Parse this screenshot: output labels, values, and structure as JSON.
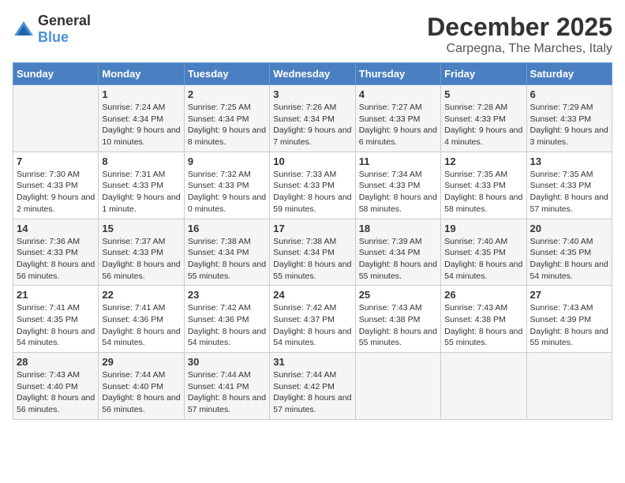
{
  "logo": {
    "general": "General",
    "blue": "Blue"
  },
  "title": "December 2025",
  "location": "Carpegna, The Marches, Italy",
  "weekdays": [
    "Sunday",
    "Monday",
    "Tuesday",
    "Wednesday",
    "Thursday",
    "Friday",
    "Saturday"
  ],
  "weeks": [
    [
      {
        "day": "",
        "sunrise": "",
        "sunset": "",
        "daylight": ""
      },
      {
        "day": "1",
        "sunrise": "Sunrise: 7:24 AM",
        "sunset": "Sunset: 4:34 PM",
        "daylight": "Daylight: 9 hours and 10 minutes."
      },
      {
        "day": "2",
        "sunrise": "Sunrise: 7:25 AM",
        "sunset": "Sunset: 4:34 PM",
        "daylight": "Daylight: 9 hours and 8 minutes."
      },
      {
        "day": "3",
        "sunrise": "Sunrise: 7:26 AM",
        "sunset": "Sunset: 4:34 PM",
        "daylight": "Daylight: 9 hours and 7 minutes."
      },
      {
        "day": "4",
        "sunrise": "Sunrise: 7:27 AM",
        "sunset": "Sunset: 4:33 PM",
        "daylight": "Daylight: 9 hours and 6 minutes."
      },
      {
        "day": "5",
        "sunrise": "Sunrise: 7:28 AM",
        "sunset": "Sunset: 4:33 PM",
        "daylight": "Daylight: 9 hours and 4 minutes."
      },
      {
        "day": "6",
        "sunrise": "Sunrise: 7:29 AM",
        "sunset": "Sunset: 4:33 PM",
        "daylight": "Daylight: 9 hours and 3 minutes."
      }
    ],
    [
      {
        "day": "7",
        "sunrise": "Sunrise: 7:30 AM",
        "sunset": "Sunset: 4:33 PM",
        "daylight": "Daylight: 9 hours and 2 minutes."
      },
      {
        "day": "8",
        "sunrise": "Sunrise: 7:31 AM",
        "sunset": "Sunset: 4:33 PM",
        "daylight": "Daylight: 9 hours and 1 minute."
      },
      {
        "day": "9",
        "sunrise": "Sunrise: 7:32 AM",
        "sunset": "Sunset: 4:33 PM",
        "daylight": "Daylight: 9 hours and 0 minutes."
      },
      {
        "day": "10",
        "sunrise": "Sunrise: 7:33 AM",
        "sunset": "Sunset: 4:33 PM",
        "daylight": "Daylight: 8 hours and 59 minutes."
      },
      {
        "day": "11",
        "sunrise": "Sunrise: 7:34 AM",
        "sunset": "Sunset: 4:33 PM",
        "daylight": "Daylight: 8 hours and 58 minutes."
      },
      {
        "day": "12",
        "sunrise": "Sunrise: 7:35 AM",
        "sunset": "Sunset: 4:33 PM",
        "daylight": "Daylight: 8 hours and 58 minutes."
      },
      {
        "day": "13",
        "sunrise": "Sunrise: 7:35 AM",
        "sunset": "Sunset: 4:33 PM",
        "daylight": "Daylight: 8 hours and 57 minutes."
      }
    ],
    [
      {
        "day": "14",
        "sunrise": "Sunrise: 7:36 AM",
        "sunset": "Sunset: 4:33 PM",
        "daylight": "Daylight: 8 hours and 56 minutes."
      },
      {
        "day": "15",
        "sunrise": "Sunrise: 7:37 AM",
        "sunset": "Sunset: 4:33 PM",
        "daylight": "Daylight: 8 hours and 56 minutes."
      },
      {
        "day": "16",
        "sunrise": "Sunrise: 7:38 AM",
        "sunset": "Sunset: 4:34 PM",
        "daylight": "Daylight: 8 hours and 55 minutes."
      },
      {
        "day": "17",
        "sunrise": "Sunrise: 7:38 AM",
        "sunset": "Sunset: 4:34 PM",
        "daylight": "Daylight: 8 hours and 55 minutes."
      },
      {
        "day": "18",
        "sunrise": "Sunrise: 7:39 AM",
        "sunset": "Sunset: 4:34 PM",
        "daylight": "Daylight: 8 hours and 55 minutes."
      },
      {
        "day": "19",
        "sunrise": "Sunrise: 7:40 AM",
        "sunset": "Sunset: 4:35 PM",
        "daylight": "Daylight: 8 hours and 54 minutes."
      },
      {
        "day": "20",
        "sunrise": "Sunrise: 7:40 AM",
        "sunset": "Sunset: 4:35 PM",
        "daylight": "Daylight: 8 hours and 54 minutes."
      }
    ],
    [
      {
        "day": "21",
        "sunrise": "Sunrise: 7:41 AM",
        "sunset": "Sunset: 4:35 PM",
        "daylight": "Daylight: 8 hours and 54 minutes."
      },
      {
        "day": "22",
        "sunrise": "Sunrise: 7:41 AM",
        "sunset": "Sunset: 4:36 PM",
        "daylight": "Daylight: 8 hours and 54 minutes."
      },
      {
        "day": "23",
        "sunrise": "Sunrise: 7:42 AM",
        "sunset": "Sunset: 4:36 PM",
        "daylight": "Daylight: 8 hours and 54 minutes."
      },
      {
        "day": "24",
        "sunrise": "Sunrise: 7:42 AM",
        "sunset": "Sunset: 4:37 PM",
        "daylight": "Daylight: 8 hours and 54 minutes."
      },
      {
        "day": "25",
        "sunrise": "Sunrise: 7:43 AM",
        "sunset": "Sunset: 4:38 PM",
        "daylight": "Daylight: 8 hours and 55 minutes."
      },
      {
        "day": "26",
        "sunrise": "Sunrise: 7:43 AM",
        "sunset": "Sunset: 4:38 PM",
        "daylight": "Daylight: 8 hours and 55 minutes."
      },
      {
        "day": "27",
        "sunrise": "Sunrise: 7:43 AM",
        "sunset": "Sunset: 4:39 PM",
        "daylight": "Daylight: 8 hours and 55 minutes."
      }
    ],
    [
      {
        "day": "28",
        "sunrise": "Sunrise: 7:43 AM",
        "sunset": "Sunset: 4:40 PM",
        "daylight": "Daylight: 8 hours and 56 minutes."
      },
      {
        "day": "29",
        "sunrise": "Sunrise: 7:44 AM",
        "sunset": "Sunset: 4:40 PM",
        "daylight": "Daylight: 8 hours and 56 minutes."
      },
      {
        "day": "30",
        "sunrise": "Sunrise: 7:44 AM",
        "sunset": "Sunset: 4:41 PM",
        "daylight": "Daylight: 8 hours and 57 minutes."
      },
      {
        "day": "31",
        "sunrise": "Sunrise: 7:44 AM",
        "sunset": "Sunset: 4:42 PM",
        "daylight": "Daylight: 8 hours and 57 minutes."
      },
      {
        "day": "",
        "sunrise": "",
        "sunset": "",
        "daylight": ""
      },
      {
        "day": "",
        "sunrise": "",
        "sunset": "",
        "daylight": ""
      },
      {
        "day": "",
        "sunrise": "",
        "sunset": "",
        "daylight": ""
      }
    ]
  ]
}
